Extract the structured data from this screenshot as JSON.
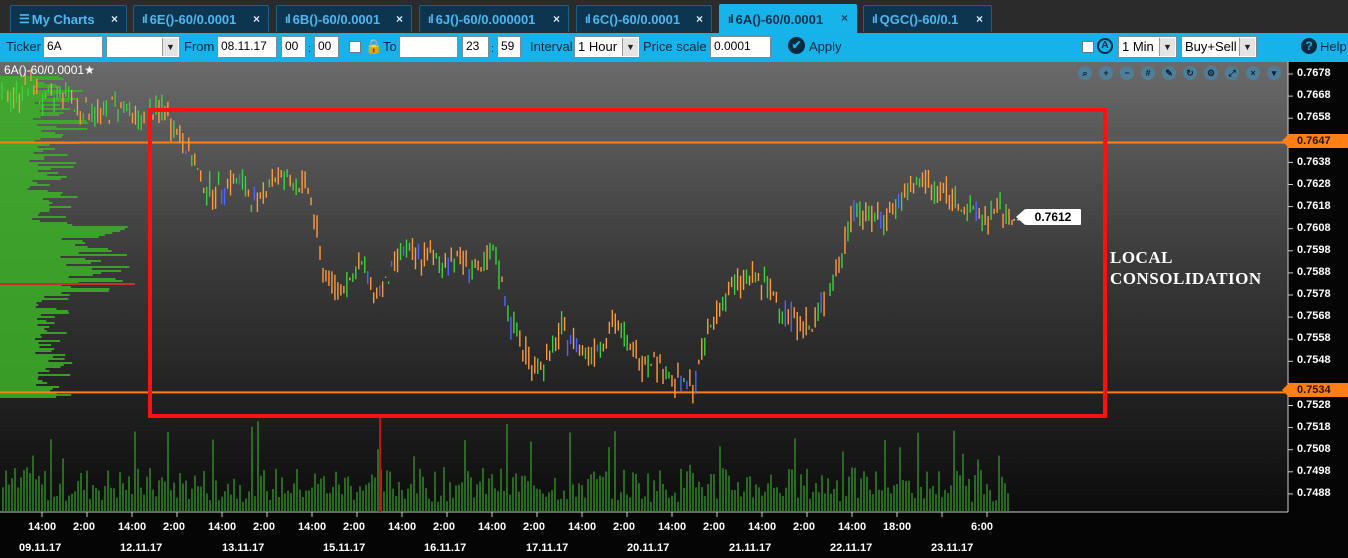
{
  "tabs": [
    {
      "label": "My Charts",
      "icon": "menu-icon",
      "active": false
    },
    {
      "label": "6E()-60/0.0001",
      "icon": "chart-icon",
      "active": false
    },
    {
      "label": "6B()-60/0.0001",
      "icon": "chart-icon",
      "active": false
    },
    {
      "label": "6J()-60/0.000001",
      "icon": "chart-icon",
      "active": false
    },
    {
      "label": "6C()-60/0.0001",
      "icon": "chart-icon",
      "active": false
    },
    {
      "label": "6A()-60/0.0001",
      "icon": "chart-icon",
      "active": true
    },
    {
      "label": "QGC()-60/0.1",
      "icon": "chart-icon",
      "active": false
    }
  ],
  "toolbar": {
    "ticker_label": "Ticker",
    "ticker_value": "6A",
    "from_label": "From",
    "from_date": "08.11.17",
    "from_hour": "00",
    "from_min": "00",
    "to_label": "To",
    "to_date": "",
    "to_hour": "23",
    "to_min": "59",
    "interval_label": "Interval",
    "interval_value": "1 Hour",
    "price_scale_label": "Price scale",
    "price_scale_value": "0.0001",
    "apply_label": "Apply",
    "timeframe_value": "1 Min",
    "side_value": "Buy+Sell",
    "help_label": "Help"
  },
  "chart": {
    "title": "6A()-60/0.0001",
    "current_price": "0.7612",
    "annotation_line1": "LOCAL",
    "annotation_line2": "CONSOLIDATION",
    "level_upper": "0.7647",
    "level_lower": "0.7534",
    "colors": {
      "level_line": "#ff7f17",
      "box": "#ff1010",
      "bar_up": "#39d43a",
      "bar_down": "#ff9a3c",
      "bar_neutral": "#5063ff",
      "volume": "#2f8a23",
      "profile": "#3cb328"
    }
  },
  "chart_data": {
    "type": "ohlc",
    "ylim": [
      0.748,
      0.7685
    ],
    "y_ticks": [
      "0.7678",
      "0.7668",
      "0.7658",
      "0.7638",
      "0.7628",
      "0.7618",
      "0.7608",
      "0.7598",
      "0.7588",
      "0.7578",
      "0.7568",
      "0.7558",
      "0.7548",
      "0.7528",
      "0.7518",
      "0.7508",
      "0.7498",
      "0.7488"
    ],
    "x_time_labels": [
      "14:00",
      "2:00",
      "14:00",
      "2:00",
      "14:00",
      "2:00",
      "14:00",
      "2:00",
      "14:00",
      "2:00",
      "14:00",
      "2:00",
      "14:00",
      "2:00",
      "14:00",
      "2:00",
      "14:00",
      "2:00",
      "14:00",
      "18:00",
      "6:00"
    ],
    "x_date_labels": [
      "09.11.17",
      "12.11.17",
      "13.11.17",
      "15.11.17",
      "16.11.17",
      "17.11.17",
      "20.11.17",
      "21.11.17",
      "22.11.17",
      "23.11.17"
    ],
    "price_path": [
      0.766,
      0.7662,
      0.7652,
      0.7642,
      0.7628,
      0.7624,
      0.763,
      0.7628,
      0.7618,
      0.763,
      0.7632,
      0.7628,
      0.7626,
      0.759,
      0.758,
      0.7585,
      0.7592,
      0.7578,
      0.7585,
      0.76,
      0.7594,
      0.7596,
      0.7592,
      0.7596,
      0.7592,
      0.7588,
      0.7598,
      0.757,
      0.7555,
      0.7545,
      0.7548,
      0.7562,
      0.7556,
      0.7552,
      0.7556,
      0.7566,
      0.7556,
      0.7548,
      0.755,
      0.7542,
      0.7538,
      0.7536,
      0.756,
      0.7574,
      0.7582,
      0.7586,
      0.7584,
      0.7578,
      0.757,
      0.7566,
      0.7562,
      0.758,
      0.759,
      0.7618,
      0.7614,
      0.7612,
      0.7617,
      0.7622,
      0.763,
      0.7626,
      0.7624,
      0.762,
      0.7615,
      0.7613,
      0.7616,
      0.7612
    ]
  }
}
